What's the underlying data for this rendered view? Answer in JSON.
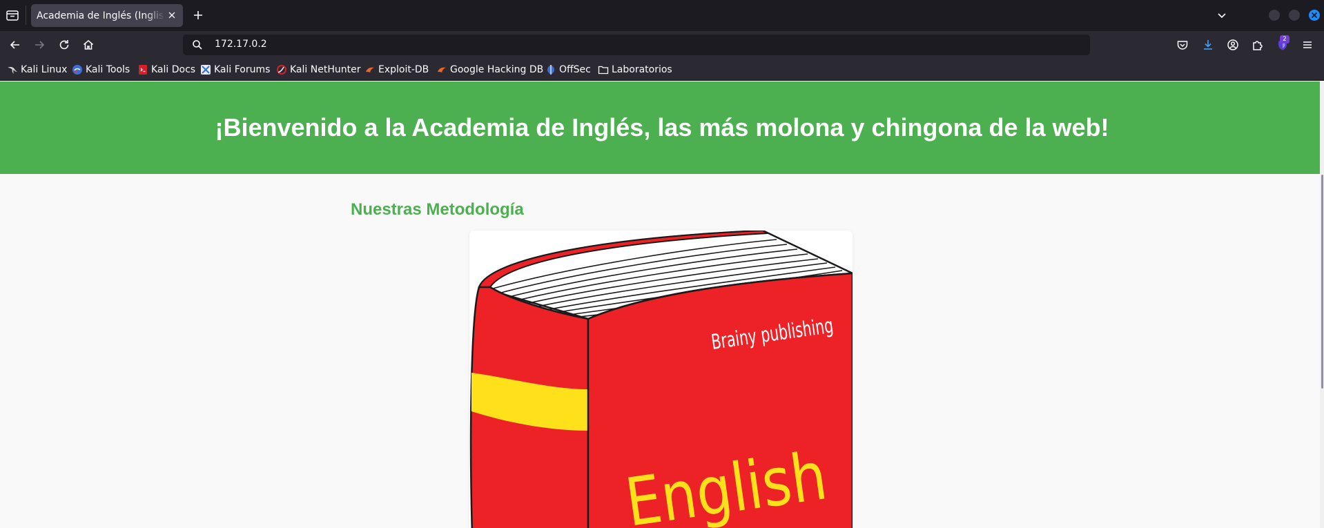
{
  "browser": {
    "tab": {
      "title": "Academia de Inglés (Inglis Academy)"
    },
    "url": "172.17.0.2",
    "extension_badge": "2",
    "bookmarks": [
      {
        "label": "Kali Linux",
        "icon": "kali-dragon-icon"
      },
      {
        "label": "Kali Tools",
        "icon": "kali-tools-icon"
      },
      {
        "label": "Kali Docs",
        "icon": "kali-docs-icon"
      },
      {
        "label": "Kali Forums",
        "icon": "kali-forums-icon"
      },
      {
        "label": "Kali NetHunter",
        "icon": "nethunter-icon"
      },
      {
        "label": "Exploit-DB",
        "icon": "exploit-db-icon"
      },
      {
        "label": "Google Hacking DB",
        "icon": "ghdb-icon"
      },
      {
        "label": "OffSec",
        "icon": "offsec-icon"
      },
      {
        "label": "Laboratorios",
        "icon": "folder-icon"
      }
    ]
  },
  "page": {
    "header_title": "¡Bienvenido a la Academia de Inglés, las más molona y chingona de la web!",
    "section_title": "Nuestras Metodología",
    "book": {
      "publisher": "Brainy publishing",
      "title": "English"
    },
    "colors": {
      "header_bg": "#4caf50",
      "section_title": "#4caf50",
      "book_red": "#ec2227",
      "book_yellow": "#ffe11b"
    }
  }
}
